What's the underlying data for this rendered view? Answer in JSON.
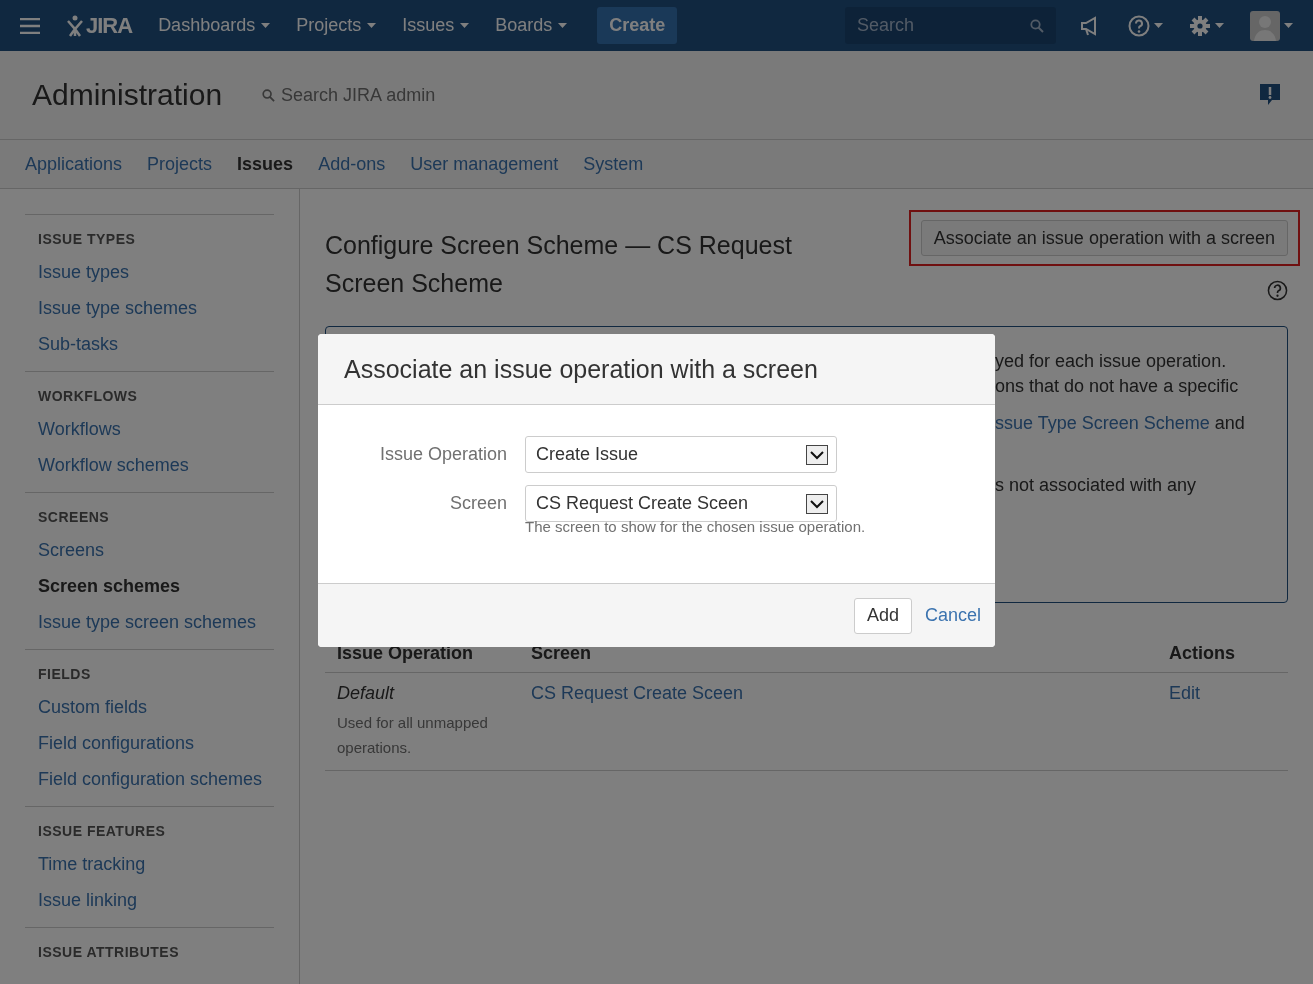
{
  "top_nav": {
    "logo": "JIRA",
    "menus": [
      {
        "label": "Dashboards"
      },
      {
        "label": "Projects"
      },
      {
        "label": "Issues"
      },
      {
        "label": "Boards"
      }
    ],
    "create": "Create",
    "search": {
      "placeholder": "Search"
    }
  },
  "admin": {
    "title": "Administration",
    "search": "Search JIRA admin"
  },
  "admin_tabs": [
    {
      "label": "Applications",
      "selected": false
    },
    {
      "label": "Projects",
      "selected": false
    },
    {
      "label": "Issues",
      "selected": true
    },
    {
      "label": "Add-ons",
      "selected": false
    },
    {
      "label": "User management",
      "selected": false
    },
    {
      "label": "System",
      "selected": false
    }
  ],
  "sidebar": {
    "sections": [
      {
        "heading": "ISSUE TYPES",
        "items": [
          {
            "label": "Issue types",
            "selected": false
          },
          {
            "label": "Issue type schemes",
            "selected": false
          },
          {
            "label": "Sub-tasks",
            "selected": false
          }
        ]
      },
      {
        "heading": "WORKFLOWS",
        "items": [
          {
            "label": "Workflows",
            "selected": false
          },
          {
            "label": "Workflow schemes",
            "selected": false
          }
        ]
      },
      {
        "heading": "SCREENS",
        "items": [
          {
            "label": "Screens",
            "selected": false
          },
          {
            "label": "Screen schemes",
            "selected": true
          },
          {
            "label": "Issue type screen schemes",
            "selected": false
          }
        ]
      },
      {
        "heading": "FIELDS",
        "items": [
          {
            "label": "Custom fields",
            "selected": false
          },
          {
            "label": "Field configurations",
            "selected": false
          },
          {
            "label": "Field configuration schemes",
            "selected": false
          }
        ]
      },
      {
        "heading": "ISSUE FEATURES",
        "items": [
          {
            "label": "Time tracking",
            "selected": false
          },
          {
            "label": "Issue linking",
            "selected": false
          }
        ]
      },
      {
        "heading": "ISSUE ATTRIBUTES"
      }
    ]
  },
  "page": {
    "title": "Configure Screen Scheme — CS Request Screen Scheme",
    "action_button": {
      "label": "Associate an issue operation with a screen",
      "highlighted": true
    },
    "info_paragraphs": [
      {
        "lines": [
          {
            "text": "yed for each issue operation."
          },
          {
            "text": "ons that do not have a specific"
          }
        ]
      },
      {
        "lines": [
          {
            "link": "ssue Type Screen Scheme",
            "text": " and"
          }
        ]
      },
      {
        "lines": [
          {
            "text": "s not associated with any"
          }
        ]
      }
    ],
    "table": {
      "columns": [
        "Issue Operation",
        "Screen",
        "Actions"
      ],
      "rows": [
        {
          "operation": "Default",
          "description": "Used for all unmapped operations.",
          "screen": "CS Request Create Sceen",
          "action": "Edit"
        }
      ]
    }
  },
  "dialog": {
    "title": "Associate an issue operation with a screen",
    "fields": [
      {
        "label": "Issue Operation",
        "value": "Create Issue"
      },
      {
        "label": "Screen",
        "value": "CS Request Create Sceen",
        "hint": "The screen to show for the chosen issue operation."
      }
    ],
    "submit": "Add",
    "cancel": "Cancel"
  }
}
